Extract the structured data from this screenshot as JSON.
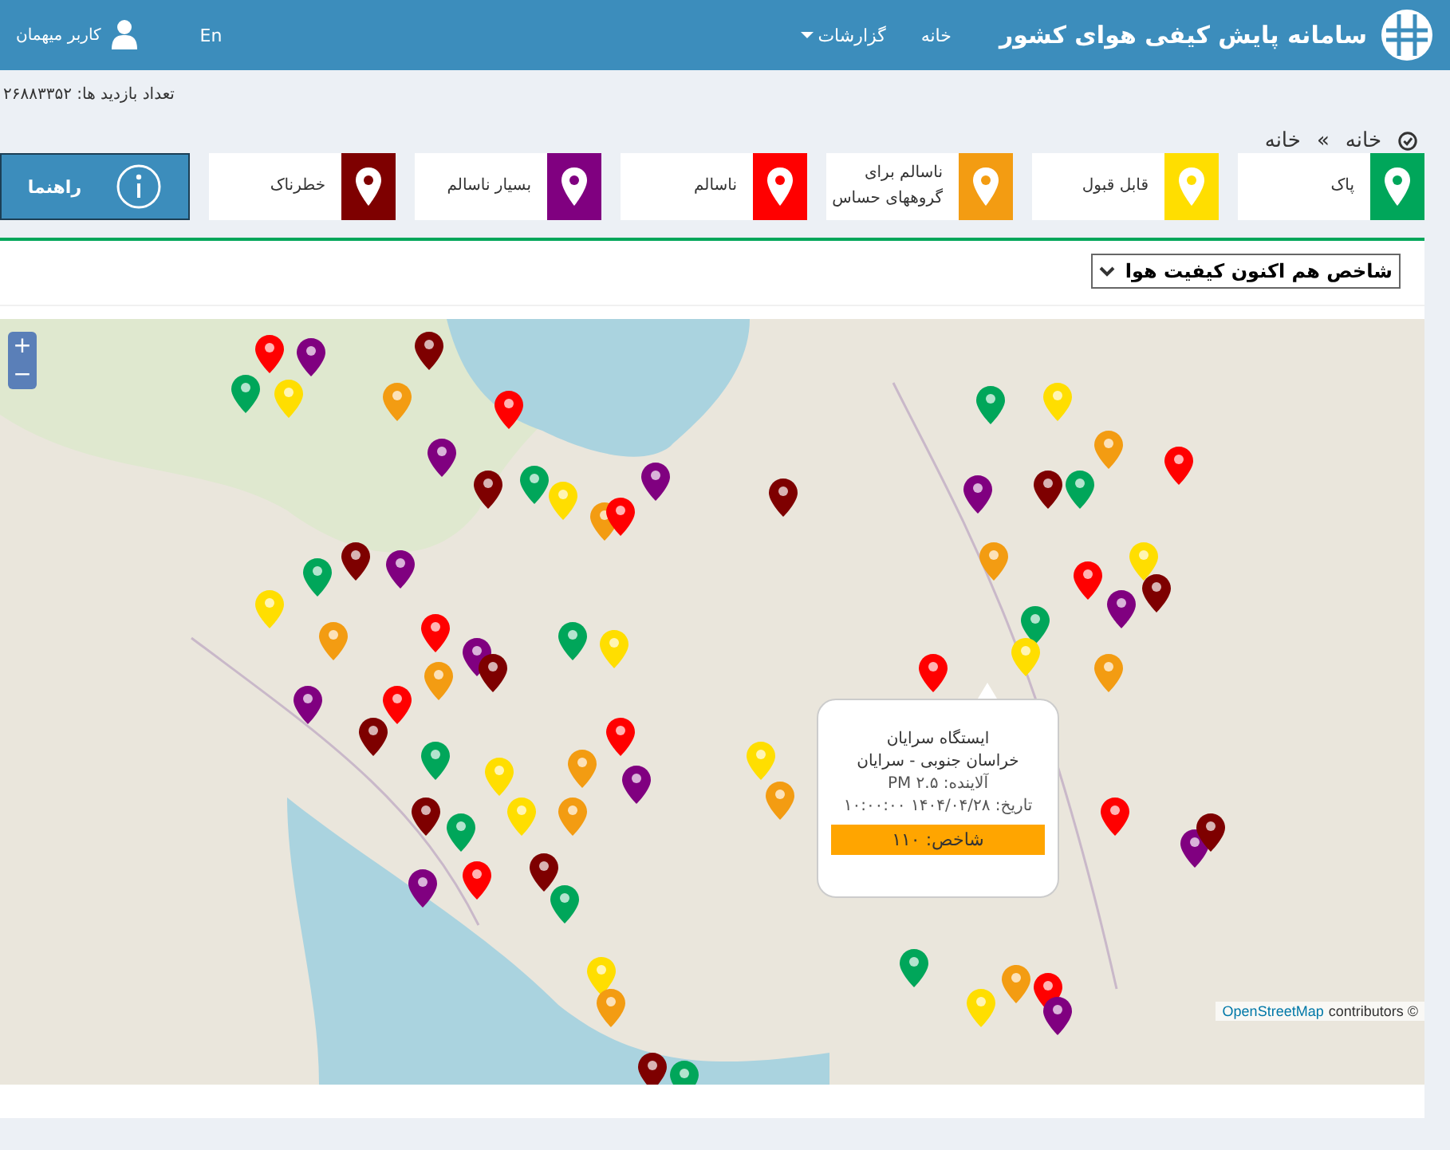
{
  "header": {
    "title": "سامانه پایش کیفی هوای کشور",
    "nav": [
      {
        "label": "خانه",
        "kind": "link"
      },
      {
        "label": "گزارشات",
        "kind": "dropdown"
      }
    ],
    "language": "En",
    "user": "کاربر میهمان"
  },
  "visits": "تعداد بازدید ها: ۲۶۸۸۳۳۵۲",
  "breadcrumb": [
    "خانه",
    "»",
    "خانه"
  ],
  "legend": [
    {
      "label": "پاک",
      "color": "#00a65a"
    },
    {
      "label": "قابل قبول",
      "color": "#ffde00"
    },
    {
      "label": "ناسالم برای\nگروههای حساس",
      "color": "#f39c12"
    },
    {
      "label": "ناسالم",
      "color": "#ff0000"
    },
    {
      "label": "بسیار ناسالم",
      "color": "#800080"
    },
    {
      "label": "خطرناک",
      "color": "#7e0000"
    }
  ],
  "help_button": "راهنما",
  "index_select": "شاخص هم اکنون کیفیت هوا",
  "map": {
    "zoom_in": "+",
    "zoom_out": "−",
    "attribution_link": "OpenStreetMap",
    "attribution": "contributors ©",
    "popup": {
      "station": "ایستگاه سرایان",
      "location": "خراسان جنوبی - سرایان",
      "pollutant": "آلاینده: PM ۲.۵",
      "date": "تاریخ: ۱۴۰۴/۰۴/۲۸ ۱۰:۰۰:۰۰",
      "index": "شاخص: ۱۱۰",
      "color": "#ffa500"
    }
  }
}
